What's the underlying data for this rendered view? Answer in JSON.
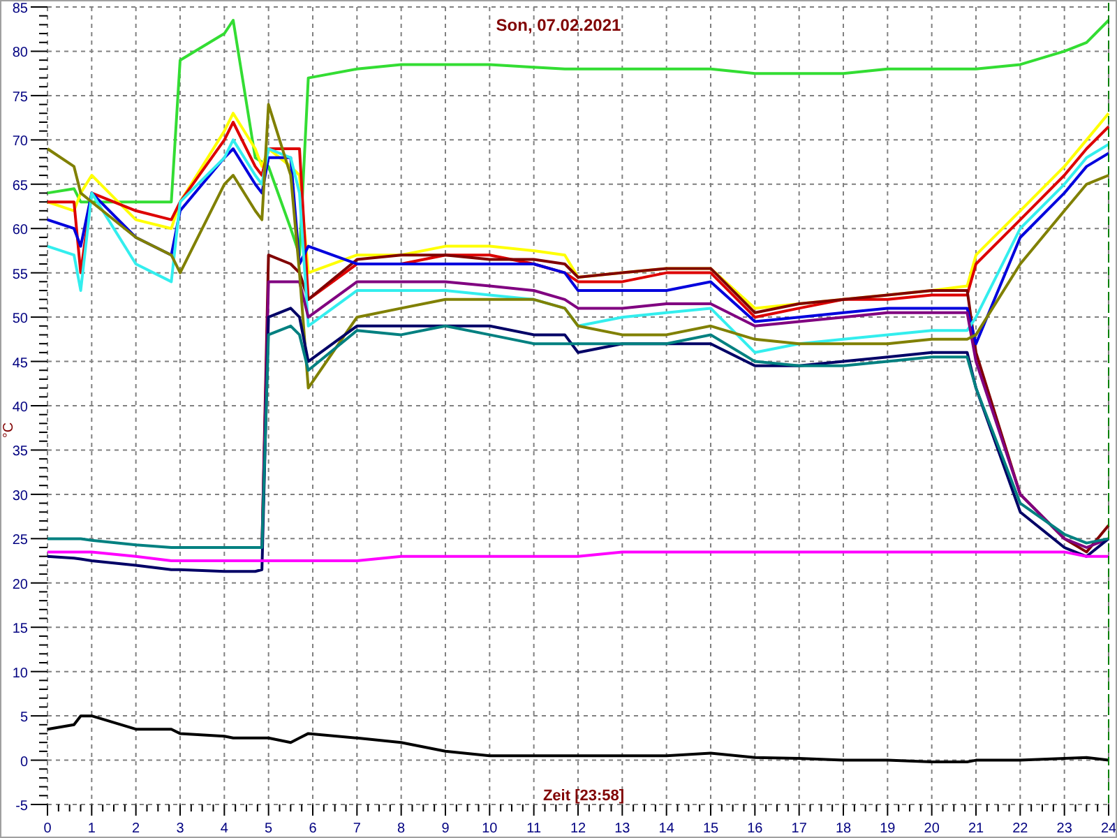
{
  "chart_data": {
    "type": "line",
    "title": "Son, 07.02.2021",
    "xlabel": "Zeit [23:58]",
    "ylabel": "°C",
    "x": [
      0,
      0.6,
      0.75,
      1,
      2,
      2.8,
      3,
      4,
      4.2,
      4.7,
      4.85,
      5,
      5.5,
      5.7,
      5.9,
      7,
      8,
      9,
      10,
      11,
      11.7,
      12,
      13,
      14,
      15,
      16,
      17,
      18,
      19,
      20,
      20.8,
      21,
      22,
      23,
      23.5,
      24
    ],
    "series": [
      {
        "color": "#33dd33",
        "values": [
          64,
          64.5,
          63,
          63,
          63,
          63,
          79,
          82,
          83.5,
          68,
          67.5,
          67,
          60,
          57,
          77,
          78,
          78.5,
          78.5,
          78.5,
          78.2,
          78,
          78,
          78,
          78,
          78,
          77.5,
          77.5,
          77.5,
          78,
          78,
          78,
          78,
          78.5,
          80,
          81,
          83.5
        ]
      },
      {
        "color": "#ffff00",
        "values": [
          63,
          62,
          64,
          66,
          61,
          60,
          63,
          71,
          73,
          69,
          67,
          69,
          67,
          66,
          55,
          57,
          57,
          58,
          58,
          57.5,
          57,
          54.5,
          55,
          55.5,
          55.5,
          51,
          51.5,
          52,
          52.5,
          53,
          53.5,
          57,
          62,
          67,
          70,
          73
        ]
      },
      {
        "color": "#dd0000",
        "values": [
          63,
          63,
          55,
          64,
          62,
          61,
          63,
          70,
          72,
          67,
          66,
          69,
          69,
          69,
          52,
          56,
          56,
          57,
          57,
          56,
          55,
          54,
          54,
          55,
          55,
          50,
          51,
          52,
          52,
          52.5,
          52.5,
          56,
          61,
          66,
          69,
          71.5
        ]
      },
      {
        "color": "#800000",
        "values": [
          null,
          null,
          null,
          null,
          null,
          null,
          null,
          null,
          null,
          null,
          24,
          57,
          56,
          55,
          52,
          56.5,
          57,
          57,
          56.5,
          56.5,
          56,
          54.5,
          55,
          55.5,
          55.5,
          50.5,
          51.5,
          52,
          52.5,
          53,
          53,
          46,
          30,
          25,
          23.5,
          26.5
        ]
      },
      {
        "color": "#0000dd",
        "values": [
          61,
          60,
          58,
          64,
          59,
          57,
          62,
          68,
          69,
          65,
          64,
          68,
          68,
          56,
          58,
          56,
          56,
          56,
          56,
          56,
          55,
          53,
          53,
          53,
          54,
          49.5,
          50,
          50.5,
          51,
          51,
          51,
          47,
          59,
          64,
          67,
          68.5
        ]
      },
      {
        "color": "#33eeee",
        "values": [
          58,
          57,
          53,
          64,
          56,
          54,
          63,
          68,
          70,
          66,
          65,
          69,
          68,
          64,
          49,
          53,
          53,
          53,
          52.5,
          52,
          51,
          49,
          50,
          50.5,
          51,
          46,
          47,
          47.5,
          48,
          48.5,
          48.5,
          50,
          60,
          65,
          68,
          69.5
        ]
      },
      {
        "color": "#800080",
        "values": [
          null,
          null,
          null,
          null,
          null,
          null,
          null,
          null,
          null,
          null,
          24,
          54,
          54,
          54,
          50,
          54,
          54,
          54,
          53.5,
          53,
          52,
          51,
          51,
          51.5,
          51.5,
          49,
          49.5,
          50,
          50.5,
          50.5,
          50.5,
          45,
          30,
          25,
          24,
          25
        ]
      },
      {
        "color": "#808000",
        "values": [
          69,
          67,
          64,
          63,
          59,
          57,
          55,
          65,
          66,
          62,
          61,
          74,
          66,
          55,
          42,
          50,
          51,
          52,
          52,
          52,
          51,
          49,
          48,
          48,
          49,
          47.5,
          47,
          47,
          47,
          47.5,
          47.5,
          48,
          56,
          62,
          65,
          66
        ]
      },
      {
        "color": "#000066",
        "values": [
          23,
          22.8,
          22.7,
          22.5,
          22,
          21.5,
          21.5,
          21.3,
          21.3,
          21.3,
          21.5,
          50,
          51,
          50,
          45,
          49,
          49,
          49,
          49,
          48,
          48,
          46,
          47,
          47,
          47,
          44.5,
          44.5,
          45,
          45.5,
          46,
          46,
          42,
          28,
          24,
          23,
          25
        ]
      },
      {
        "color": "#008080",
        "values": [
          25,
          25,
          25,
          24.8,
          24.3,
          24,
          24,
          24,
          24,
          24,
          24,
          48,
          49,
          48,
          44,
          48.5,
          48,
          49,
          48,
          47,
          47,
          47,
          47,
          47,
          48,
          45,
          44.5,
          44.5,
          45,
          45.5,
          45.5,
          42,
          29,
          25.5,
          24.5,
          25
        ]
      },
      {
        "color": "#ff00ff",
        "values": [
          23.5,
          23.5,
          23.5,
          23.5,
          23,
          22.5,
          22.5,
          22.5,
          22.5,
          22.5,
          22.5,
          22.5,
          22.5,
          22.5,
          22.5,
          22.5,
          23,
          23,
          23,
          23,
          23,
          23,
          23.5,
          23.5,
          23.5,
          23.5,
          23.5,
          23.5,
          23.5,
          23.5,
          23.5,
          23.5,
          23.5,
          23.5,
          23,
          23
        ]
      },
      {
        "color": "#000000",
        "values": [
          3.5,
          4,
          5,
          5,
          3.5,
          3.5,
          3,
          2.7,
          2.5,
          2.5,
          2.5,
          2.5,
          2,
          2.5,
          3,
          2.5,
          2,
          1,
          0.5,
          0.5,
          0.5,
          0.5,
          0.5,
          0.5,
          0.8,
          0.3,
          0.2,
          0,
          0,
          -0.2,
          -0.2,
          0,
          0,
          0.2,
          0.3,
          0
        ]
      }
    ],
    "grid": true,
    "xlim": [
      0,
      24
    ],
    "ylim": [
      -5,
      85
    ],
    "xticks": [
      0,
      1,
      2,
      3,
      4,
      5,
      6,
      7,
      8,
      9,
      10,
      11,
      12,
      13,
      14,
      15,
      16,
      17,
      18,
      19,
      20,
      21,
      22,
      23,
      24
    ],
    "yticks": [
      -5,
      0,
      5,
      10,
      15,
      20,
      25,
      30,
      35,
      40,
      45,
      50,
      55,
      60,
      65,
      70,
      75,
      80,
      85
    ]
  }
}
